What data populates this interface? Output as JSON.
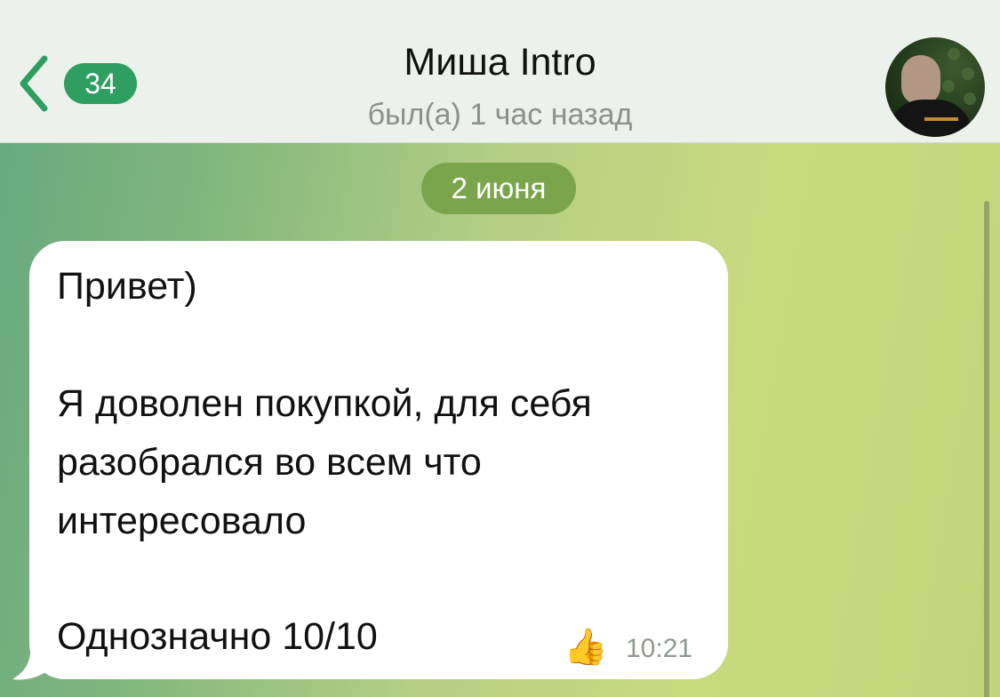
{
  "header": {
    "back_label": "",
    "unread_count": "34",
    "title": "Миша Intro",
    "subtitle": "был(а) 1 час назад"
  },
  "chat": {
    "date_separator": "2 июня",
    "message": {
      "line1": "Привет)",
      "line2": "Я доволен покупкой, для себя",
      "line3": "разобрался во всем что",
      "line4": "интересовало",
      "line5": "Однозначно 10/10",
      "reaction_icon": "thumbs-up-icon",
      "time": "10:21"
    }
  },
  "colors": {
    "accent": "#2f9e61",
    "header_bg": "#edf1ec",
    "date_pill": "#7ba54c"
  }
}
